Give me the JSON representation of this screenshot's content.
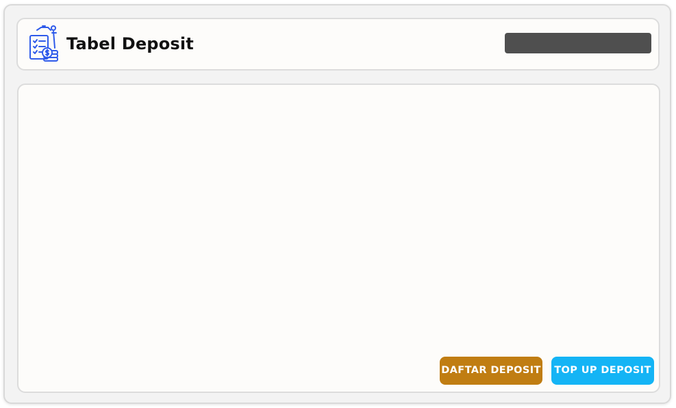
{
  "header": {
    "title": "Tabel Deposit",
    "icon": "deposit-ledger-icon",
    "search_value": ""
  },
  "actions": {
    "daftar_label": "DAFTAR DEPOSIT",
    "topup_label": "TOP UP DEPOSIT"
  },
  "colors": {
    "daftar_button": "#c07d12",
    "topup_button": "#14b4f5",
    "icon_blue": "#2f5bea",
    "search_bar": "#4f4f4f"
  }
}
